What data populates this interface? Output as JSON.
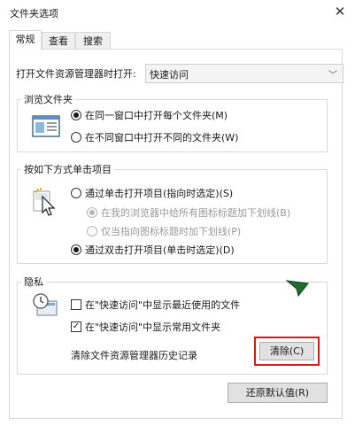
{
  "window": {
    "title": "文件夹选项"
  },
  "tabs": [
    {
      "label": "常规"
    },
    {
      "label": "查看"
    },
    {
      "label": "搜索"
    }
  ],
  "open_explorer": {
    "label": "打开文件资源管理器时打开:",
    "value": "快速访问"
  },
  "browse_folders": {
    "legend": "浏览文件夹",
    "options": [
      {
        "label": "在同一窗口中打开每个文件夹(M)",
        "selected": true
      },
      {
        "label": "在不同窗口中打开不同的文件夹(W)",
        "selected": false
      }
    ]
  },
  "click_items": {
    "legend": "按如下方式单击项目",
    "options": [
      {
        "label": "通过单击打开项目(指向时选定)(S)",
        "selected": false
      },
      {
        "label": "在我的浏览器中给所有图标标题加下划线(B)",
        "selected": true,
        "disabled": true
      },
      {
        "label": "仅当指向图标标题时加下划线(P)",
        "selected": false,
        "disabled": true
      },
      {
        "label": "通过双击打开项目(单击时选定)(D)",
        "selected": true
      }
    ]
  },
  "privacy": {
    "legend": "隐私",
    "show_recent": {
      "label": "在\"快速访问\"中显示最近使用的文件",
      "checked": false
    },
    "show_frequent": {
      "label": "在\"快速访问\"中显示常用文件夹",
      "checked": true
    },
    "clear_label": "清除文件资源管理器历史记录",
    "clear_button": "清除(C)"
  },
  "restore_button": "还原默认值(R)",
  "colors": {
    "highlight": "#d11a1a",
    "accent_green": "#1e6e2e"
  }
}
